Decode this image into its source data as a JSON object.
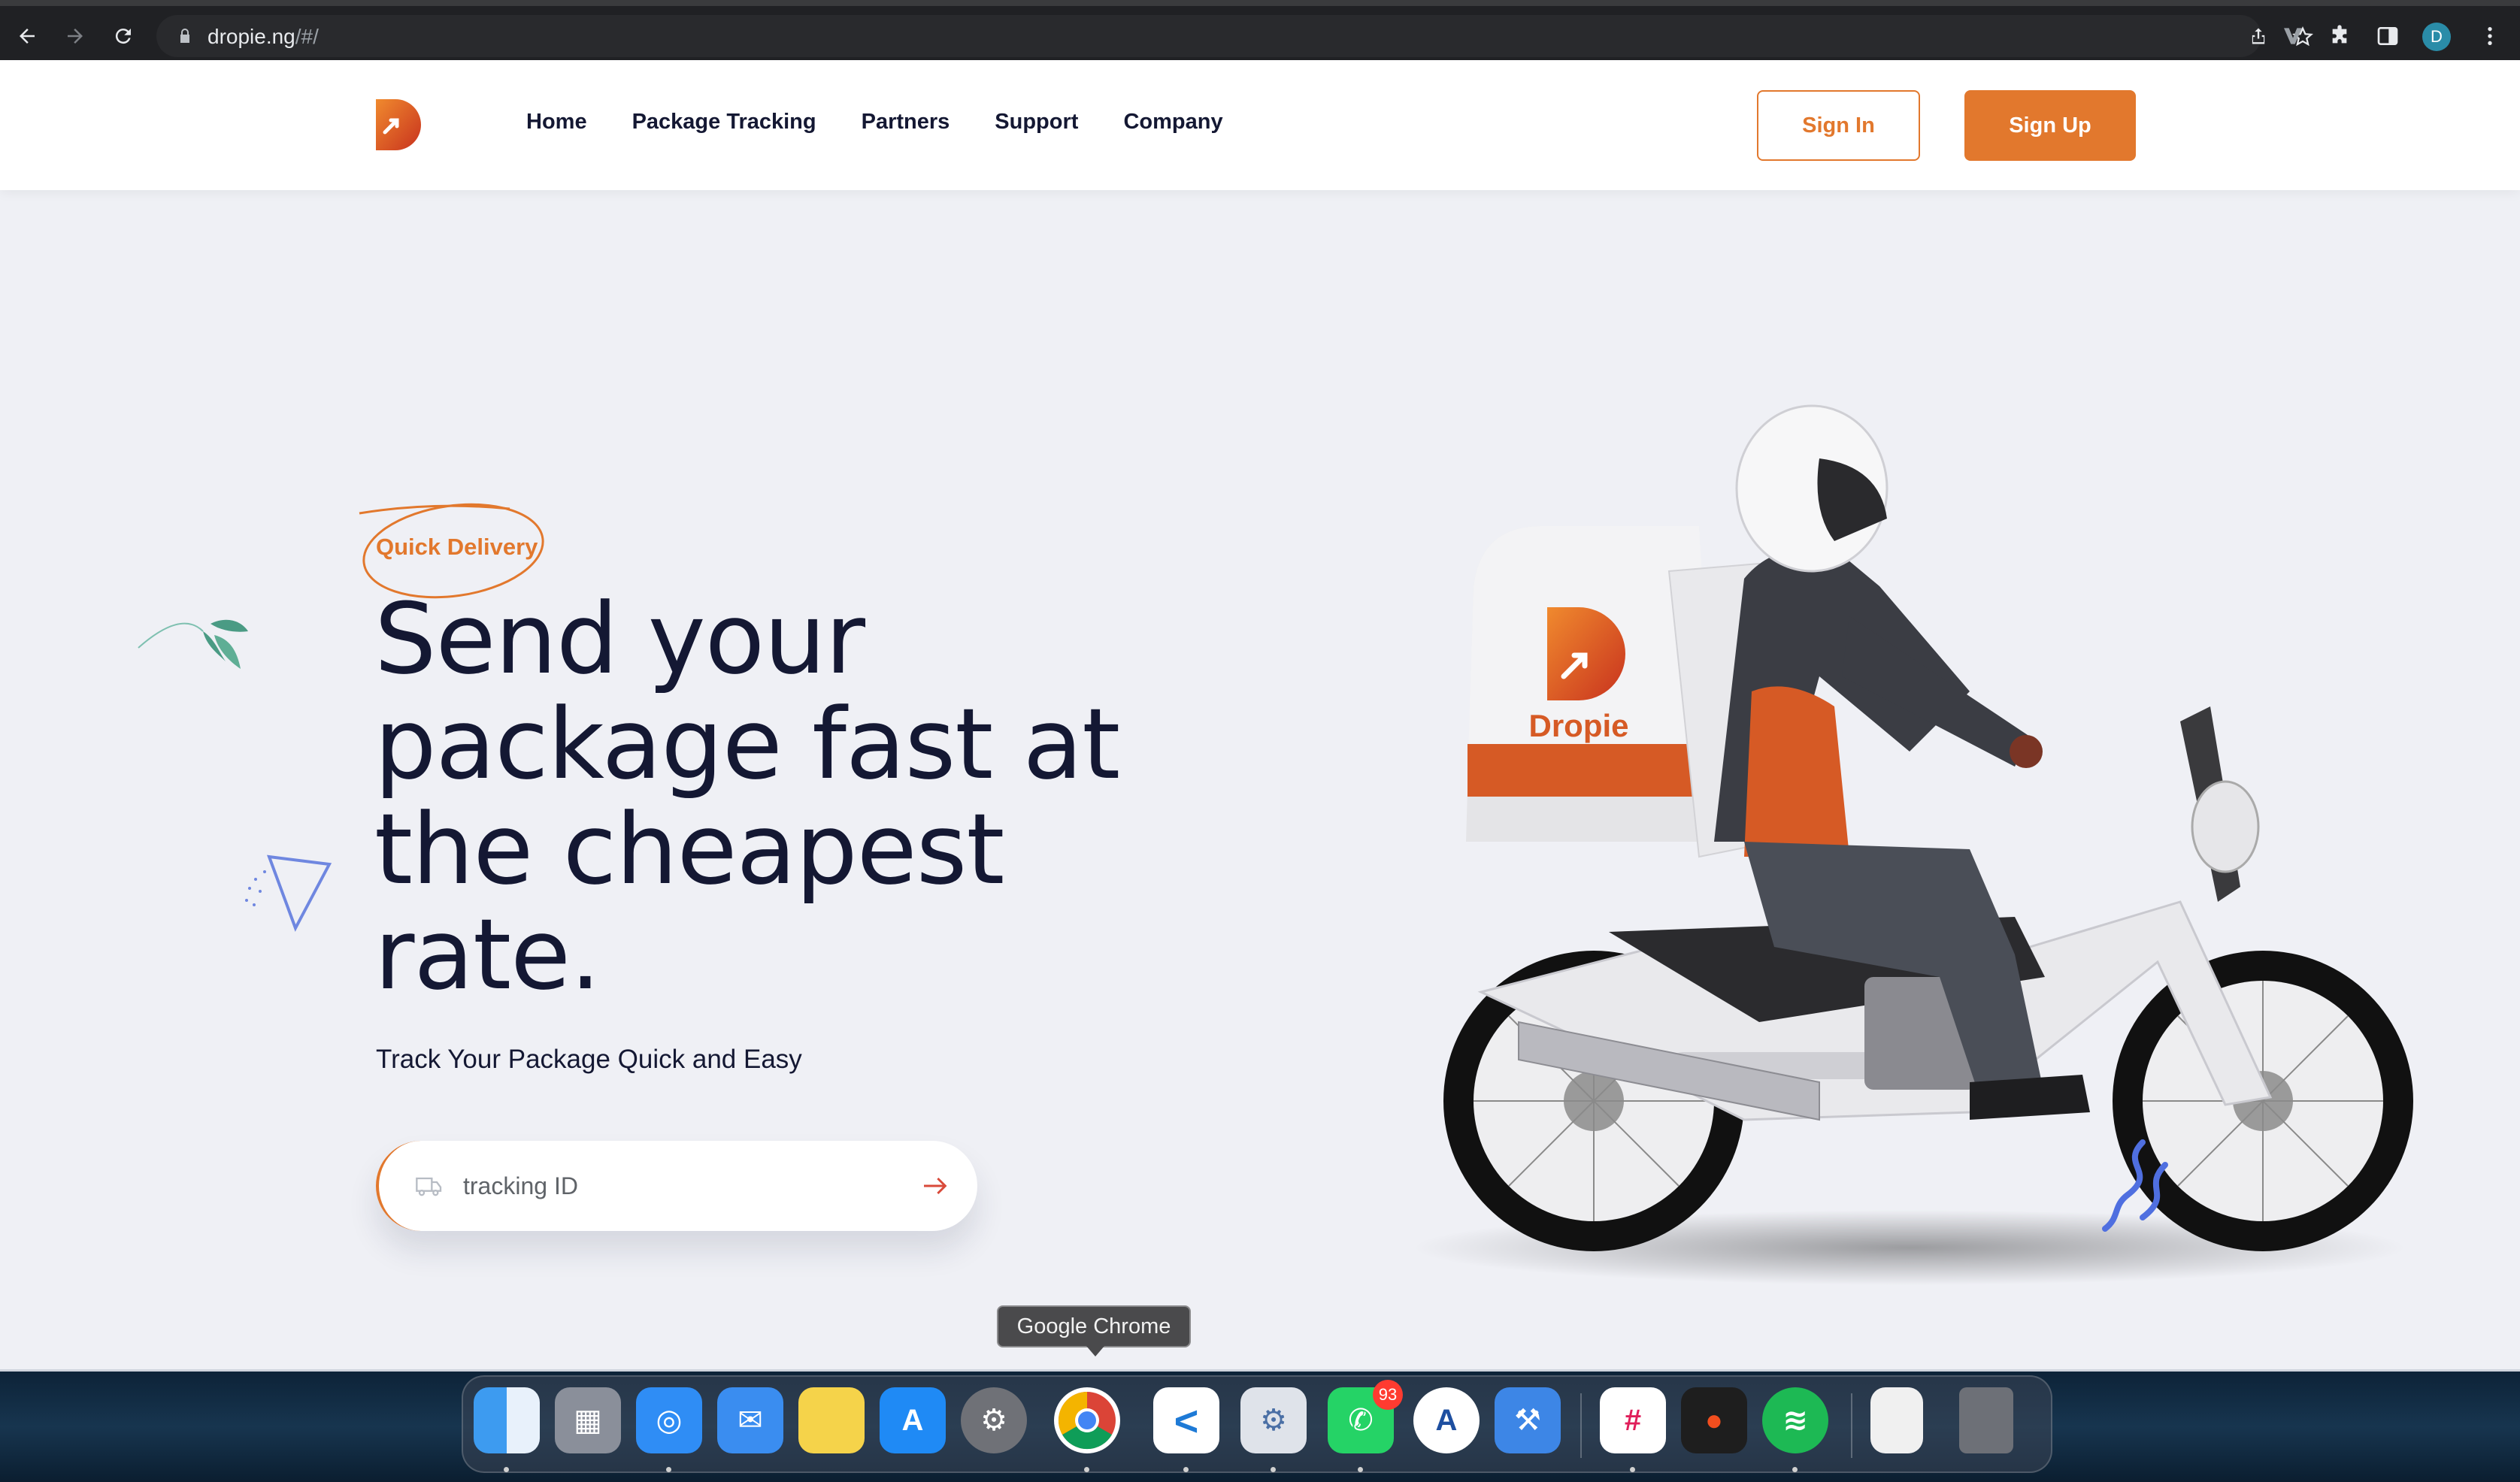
{
  "browser": {
    "url_host": "dropie.ng",
    "url_path": "/#/",
    "profile_initial": "D"
  },
  "site": {
    "nav": [
      "Home",
      "Package Tracking",
      "Partners",
      "Support",
      "Company"
    ],
    "sign_in": "Sign In",
    "sign_up": "Sign Up",
    "brand_color": "#e2782d",
    "text_color": "#141833"
  },
  "hero": {
    "tag": "Quick Delivery",
    "title": "Send your package fast at the cheapest rate.",
    "subtitle": "Track Your Package Quick and Easy",
    "tracking_placeholder": "tracking ID",
    "box_brand": "Dropie"
  },
  "dock": {
    "tooltip": "Google Chrome",
    "whatsapp_badge": "93",
    "apps": [
      "Finder",
      "Launchpad",
      "Safari",
      "Mail",
      "Notes",
      "App Store",
      "System Preferences",
      "Google Chrome",
      "Visual Studio Code",
      "Settings",
      "WhatsApp",
      "Instruments",
      "Xcode",
      "Slack",
      "Figma",
      "Spotify",
      "Archive",
      "Trash"
    ]
  }
}
